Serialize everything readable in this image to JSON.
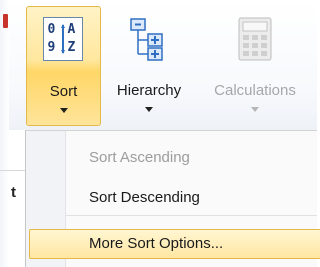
{
  "ribbon": {
    "sort": {
      "label": "Sort",
      "icon": "sort-az-icon",
      "icon_text": [
        "0",
        "A",
        "9",
        "Z"
      ]
    },
    "hierarchy": {
      "label": "Hierarchy",
      "icon": "hierarchy-icon"
    },
    "calculations": {
      "label": "Calculations",
      "icon": "calculator-icon",
      "disabled": true
    }
  },
  "menu": {
    "items": [
      {
        "label": "Sort Ascending",
        "disabled": true
      },
      {
        "label": "Sort Descending",
        "disabled": false
      },
      {
        "label": "More Sort Options...",
        "highlighted": true
      }
    ]
  },
  "background": {
    "partial_text": "t"
  },
  "colors": {
    "highlight_border": "#e5b84a",
    "highlight_fill": "#ffe79e",
    "disabled_text": "#9d9d9d",
    "icon_blue": "#2f6fc2"
  }
}
